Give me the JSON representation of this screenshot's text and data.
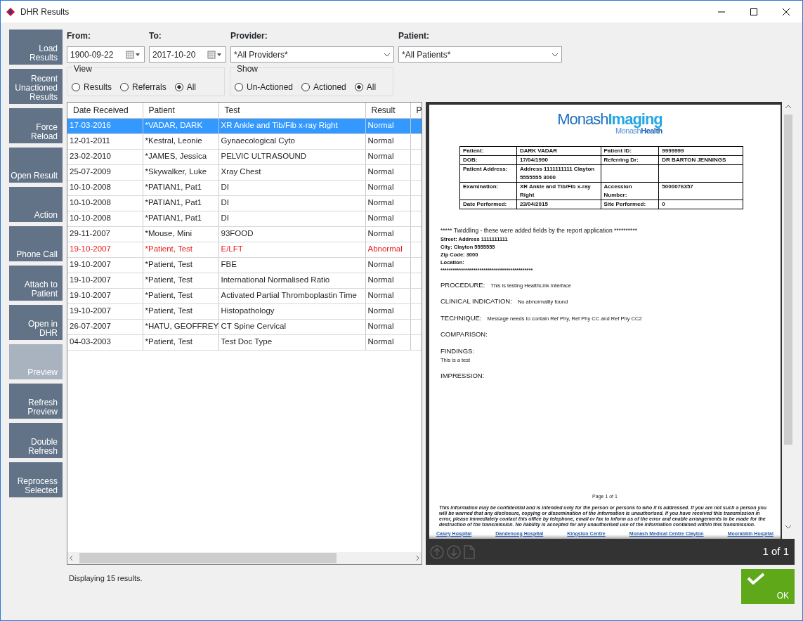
{
  "window": {
    "title": "DHR Results"
  },
  "sidebar_buttons": [
    {
      "label": "Load Results",
      "disabled": false
    },
    {
      "label": "Recent Unactioned Results",
      "disabled": false
    },
    {
      "label": "Force Reload",
      "disabled": false
    },
    {
      "label": "Open Result",
      "disabled": false
    },
    {
      "label": "Action",
      "disabled": false
    },
    {
      "label": "Phone Call",
      "disabled": false
    },
    {
      "label": "Attach to Patient",
      "disabled": false
    },
    {
      "label": "Open in DHR",
      "disabled": false
    },
    {
      "label": "Preview",
      "disabled": true
    },
    {
      "label": "Refresh Preview",
      "disabled": false
    },
    {
      "label": "Double Refresh",
      "disabled": false
    },
    {
      "label": "Reprocess Selected",
      "disabled": false
    }
  ],
  "filters": [
    {
      "kind": "date",
      "label": "From:",
      "value": "1900-09-22"
    },
    {
      "kind": "date",
      "label": "To:",
      "value": "2017-10-20"
    },
    {
      "kind": "dropdown",
      "label": "Provider:",
      "value": "*All Providers*"
    },
    {
      "kind": "dropdown",
      "label": "Patient:",
      "value": "*All Patients*"
    }
  ],
  "option_groups": [
    {
      "title": "View",
      "options": [
        {
          "label": "Results",
          "selected": false
        },
        {
          "label": "Referrals",
          "selected": false
        },
        {
          "label": "All",
          "selected": true
        }
      ]
    },
    {
      "title": "Show",
      "options": [
        {
          "label": "Un-Actioned",
          "selected": false
        },
        {
          "label": "Actioned",
          "selected": false
        },
        {
          "label": "All",
          "selected": true
        }
      ]
    }
  ],
  "table": {
    "columns": [
      "Date Received",
      "Patient",
      "Test",
      "Result",
      "P"
    ],
    "rows": [
      {
        "cells": [
          "17-03-2016",
          "*VADAR, DARK",
          "XR Ankle and Tib/Fib x-ray Right",
          "Normal"
        ],
        "selected": true,
        "abnormal": false
      },
      {
        "cells": [
          "12-01-2011",
          "*Kestral, Leonie",
          "Gynaecological Cyto",
          "Normal"
        ],
        "selected": false,
        "abnormal": false
      },
      {
        "cells": [
          "23-02-2010",
          "*JAMES, Jessica",
          "PELVIC ULTRASOUND",
          "Normal"
        ],
        "selected": false,
        "abnormal": false
      },
      {
        "cells": [
          "25-07-2009",
          "*Skywalker, Luke",
          "Xray Chest",
          "Normal"
        ],
        "selected": false,
        "abnormal": false
      },
      {
        "cells": [
          "10-10-2008",
          "*PATIAN1, Pat1",
          "DI",
          "Normal"
        ],
        "selected": false,
        "abnormal": false
      },
      {
        "cells": [
          "10-10-2008",
          "*PATIAN1, Pat1",
          "DI",
          "Normal"
        ],
        "selected": false,
        "abnormal": false
      },
      {
        "cells": [
          "10-10-2008",
          "*PATIAN1, Pat1",
          "DI",
          "Normal"
        ],
        "selected": false,
        "abnormal": false
      },
      {
        "cells": [
          "29-11-2007",
          "*Mouse, Mini",
          "93FOOD",
          "Normal"
        ],
        "selected": false,
        "abnormal": false
      },
      {
        "cells": [
          "19-10-2007",
          "*Patient, Test",
          "E/LFT",
          "Abnormal"
        ],
        "selected": false,
        "abnormal": true
      },
      {
        "cells": [
          "19-10-2007",
          "*Patient, Test",
          "FBE",
          "Normal"
        ],
        "selected": false,
        "abnormal": false
      },
      {
        "cells": [
          "19-10-2007",
          "*Patient, Test",
          "International Normalised Ratio",
          "Normal"
        ],
        "selected": false,
        "abnormal": false
      },
      {
        "cells": [
          "19-10-2007",
          "*Patient, Test",
          "Activated Partial Thromboplastin Time",
          "Normal"
        ],
        "selected": false,
        "abnormal": false
      },
      {
        "cells": [
          "19-10-2007",
          "*Patient, Test",
          "Histopathology",
          "Normal"
        ],
        "selected": false,
        "abnormal": false
      },
      {
        "cells": [
          "26-07-2007",
          "*HATU, GEOFFREY",
          "CT Spine Cervical",
          "Normal"
        ],
        "selected": false,
        "abnormal": false
      },
      {
        "cells": [
          "04-03-2003",
          "*Patient, Test",
          "Test Doc Type",
          "Normal"
        ],
        "selected": false,
        "abnormal": false
      }
    ]
  },
  "status": "Displaying 15 results.",
  "preview": {
    "logo": {
      "main": "Monash**Imaging**",
      "sub": "Monash**Health**"
    },
    "info_rows": [
      [
        "Patient:",
        "DARK  VADAR",
        "Patient ID:",
        "9999999"
      ],
      [
        "DOB:",
        "17/04/1990",
        "Referring Dr:",
        "DR BARTON JENNINGS"
      ],
      [
        "Patient Address:",
        "Address 1111111111 Clayton 5555555 3000",
        "",
        ""
      ],
      [
        "Examination:",
        "XR Ankle and Tib/Fib x-ray Right",
        "Accession Number:",
        "5000076357"
      ],
      [
        "Date Performed:",
        "23/04/2015",
        "Site Performed:",
        "0"
      ]
    ],
    "banner": "***** Twiddling - these were added fields by the report application **********",
    "address_lines": [
      "Street: Address 1111111111",
      "City: Clayton 5555555",
      "Zip Code: 3000",
      "Location:",
      "*********************************************"
    ],
    "sections": [
      {
        "heading": "PROCEDURE:",
        "text": "This is testing HealthLink Interface",
        "inline": true
      },
      {
        "heading": "CLINICAL INDICATION:",
        "text": "No abnormality found",
        "inline": true
      },
      {
        "heading": "TECHNIQUE:",
        "text": "Message needs to contain Ref Phy, Ref Phy CC and Ref Phy CC2",
        "inline": true
      },
      {
        "heading": "COMPARISON:"
      },
      {
        "heading": "FINDINGS:",
        "text": "This is a test",
        "inline": false
      },
      {
        "heading": "IMPRESSION:"
      }
    ],
    "page_number": "Page 1 of 1",
    "disclaimer": "This information may be confidential and is intended only for the person or persons to who it is addressed.  If you are not such a person you will be warned that any disclosure, copying or dissemination of the information is unauthorised.  If you have received this transmission in error, please immediately contact this office by telephone, email or fax to inform us of the error and enable arrangements to be made for the destruction of the transmission.  No liability is accepted for any unauthorised use of the information contained within this transmission.",
    "sites": [
      "Casey Hospital",
      "Dandenong Hospital",
      "Kingston Centre",
      "Monash Medical Centre Clayton",
      "Moorabbin Hospital"
    ],
    "pager": "1 of 1"
  },
  "ok_button": "OK"
}
